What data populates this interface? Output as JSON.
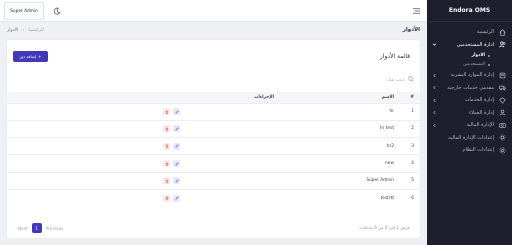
{
  "app": {
    "brand": "Endora OMS"
  },
  "topbar": {
    "user_label": "Super Admin"
  },
  "sidebar": {
    "items": [
      {
        "label": "الرئيسية",
        "icon": "home-icon",
        "has_chevron": false
      },
      {
        "label": "ادارة المستخدمين",
        "icon": "users-icon",
        "has_chevron": true,
        "active": true
      },
      {
        "label": "إدارة الموارد البشرية",
        "icon": "hr-icon",
        "has_chevron": true
      },
      {
        "label": "مقدمي خدمات خارجية",
        "icon": "truck-icon",
        "has_chevron": true
      },
      {
        "label": "إدارة الخدمات",
        "icon": "services-icon",
        "has_chevron": true
      },
      {
        "label": "إدارة العملاء",
        "icon": "clients-icon",
        "has_chevron": true
      },
      {
        "label": "الإدارة المالية",
        "icon": "finance-icon",
        "has_chevron": true
      },
      {
        "label": "إعدادات الإدارة المالية",
        "icon": "finance-settings-icon",
        "has_chevron": false
      },
      {
        "label": "إعدادات النظام",
        "icon": "settings-icon",
        "has_chevron": false
      }
    ],
    "subitems": [
      {
        "label": "الادوار",
        "current": true
      },
      {
        "label": "المستخدمين",
        "current": false
      }
    ]
  },
  "breadcrumb": {
    "title": "الأدوار",
    "home": "الرئيسية",
    "separator": "‹",
    "current": "الأدوار"
  },
  "card": {
    "title": "قائمة الأدوار",
    "add_button": "إضافة دور",
    "search_placeholder": "ابحث هنا..."
  },
  "table": {
    "headers": {
      "num": "#",
      "name": "الاسم",
      "actions": "الإجراءات"
    },
    "rows": [
      {
        "num": "1",
        "name": "hr"
      },
      {
        "num": "2",
        "name": "hr test"
      },
      {
        "num": "3",
        "name": "hr2"
      },
      {
        "num": "4",
        "name": "new"
      },
      {
        "num": "5",
        "name": "Super Admin"
      },
      {
        "num": "6",
        "name": "testrtt"
      }
    ]
  },
  "footer": {
    "showing": "عرض 1 إلى 6 من 6 مدخلات",
    "next": "Next",
    "page": "1",
    "previous": "Previous"
  },
  "colors": {
    "sidebar_bg": "#1e1e2d",
    "accent": "#4338b8",
    "danger": "#e5484d"
  }
}
